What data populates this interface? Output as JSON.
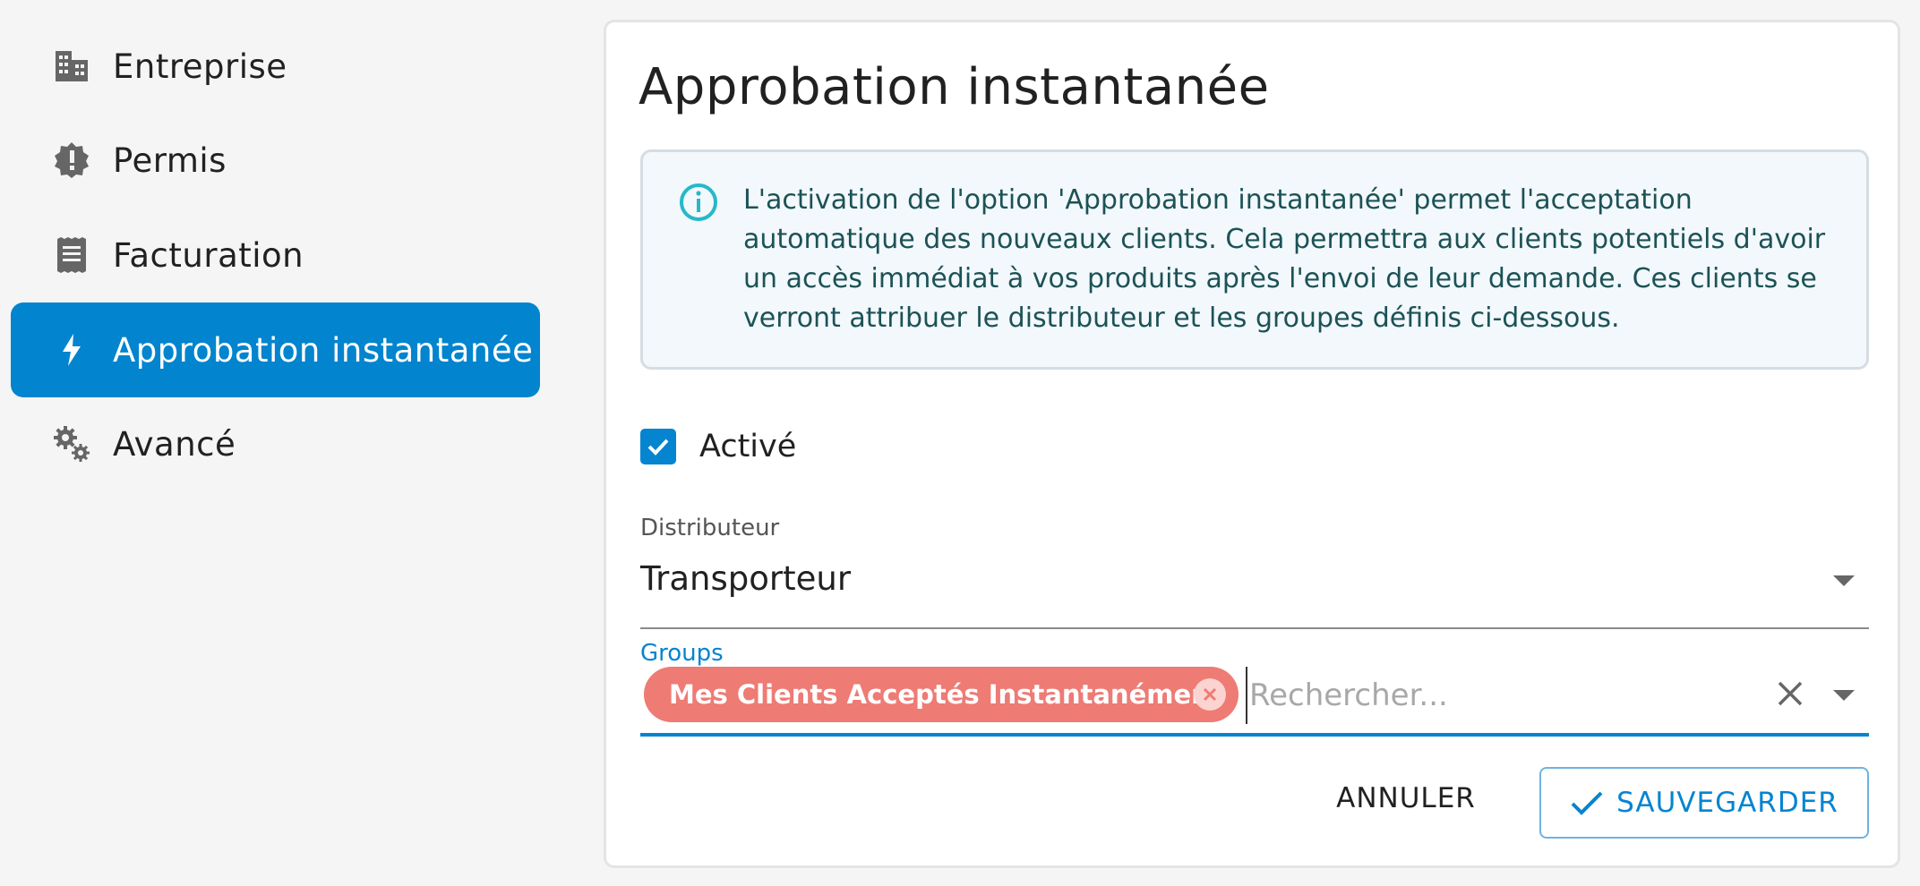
{
  "sidebar": {
    "items": [
      {
        "label": "Entreprise",
        "icon": "building-icon"
      },
      {
        "label": "Permis",
        "icon": "alert-badge-icon"
      },
      {
        "label": "Facturation",
        "icon": "receipt-icon"
      },
      {
        "label": "Approbation instantanée",
        "icon": "bolt-icon",
        "active": true
      },
      {
        "label": "Avancé",
        "icon": "gears-icon"
      }
    ]
  },
  "main": {
    "title": "Approbation instantanée",
    "info": {
      "icon": "info-icon",
      "text": "L'activation de l'option 'Approbation instantanée' permet l'acceptation automatique des nouveaux clients. Cela permettra aux clients potentiels d'avoir un accès immédiat à vos produits après l'envoi de leur demande. Ces clients se verront attribuer le distributeur et les groupes définis ci-dessous."
    },
    "enabled": {
      "label": "Activé",
      "checked": true
    },
    "distributor": {
      "label": "Distributeur",
      "value": "Transporteur"
    },
    "groups": {
      "label": "Groups",
      "chips": [
        "Mes Clients Acceptés Instantanément"
      ],
      "placeholder": "Rechercher..."
    },
    "actions": {
      "cancel_label": "ANNULER",
      "save_label": "SAUVEGARDER"
    }
  },
  "colors": {
    "accent": "#0584d0",
    "active_nav": "#0284ce",
    "chip": "#ee7b74",
    "info_icon": "#26b8c8",
    "info_text": "#1c5256"
  }
}
